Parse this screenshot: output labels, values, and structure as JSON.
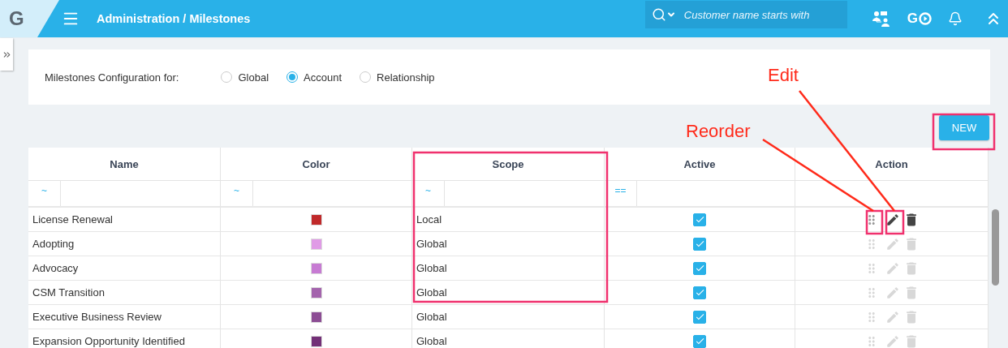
{
  "app": {
    "logo": "G",
    "breadcrumb": "Administration / Milestones",
    "search": {
      "placeholder": "Customer name starts with"
    },
    "go_label": "G"
  },
  "config": {
    "label": "Milestones Configuration for:",
    "options": [
      {
        "label": "Global",
        "selected": false
      },
      {
        "label": "Account",
        "selected": true
      },
      {
        "label": "Relationship",
        "selected": false
      }
    ]
  },
  "new_button": "NEW",
  "table": {
    "columns": [
      {
        "label": "Name",
        "filter_operator": "~"
      },
      {
        "label": "Color",
        "filter_operator": "~"
      },
      {
        "label": "Scope",
        "filter_operator": "~"
      },
      {
        "label": "Active",
        "filter_operator": "=="
      },
      {
        "label": "Action"
      }
    ],
    "rows": [
      {
        "name": "License Renewal",
        "color": "#c0292a",
        "scope": "Local",
        "active": true,
        "highlighted": true
      },
      {
        "name": "Adopting",
        "color": "#e09be6",
        "scope": "Global",
        "active": true,
        "highlighted": false
      },
      {
        "name": "Advocacy",
        "color": "#c77bd3",
        "scope": "Global",
        "active": true,
        "highlighted": false
      },
      {
        "name": "CSM Transition",
        "color": "#a464ad",
        "scope": "Global",
        "active": true,
        "highlighted": false
      },
      {
        "name": "Executive Business Review",
        "color": "#8c4d94",
        "scope": "Global",
        "active": true,
        "highlighted": false
      },
      {
        "name": "Expansion Opportunity Identified",
        "color": "#733077",
        "scope": "Global",
        "active": true,
        "highlighted": false
      }
    ]
  },
  "annotations": [
    {
      "label": "Edit"
    },
    {
      "label": "Reorder"
    }
  ]
}
